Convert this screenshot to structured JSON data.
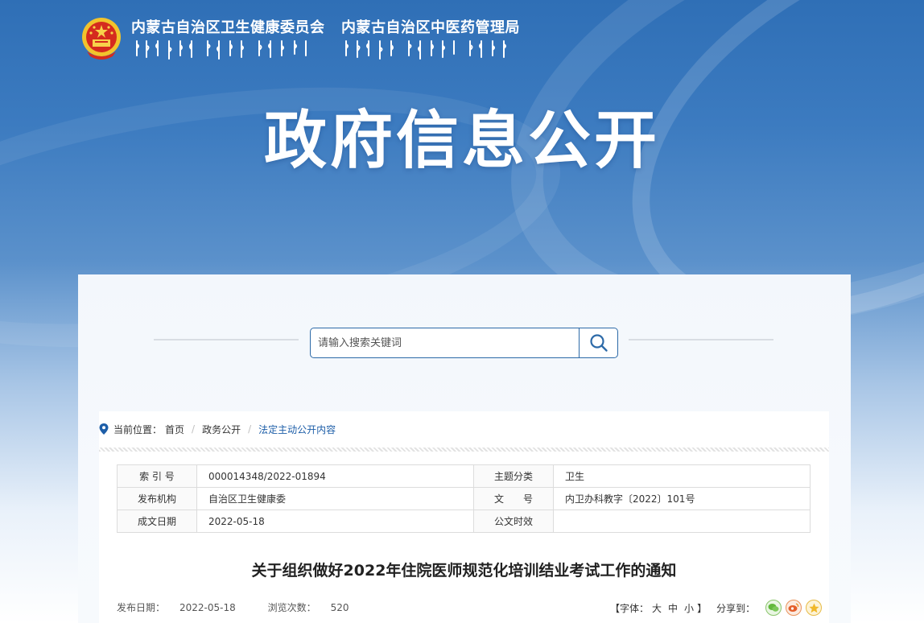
{
  "header": {
    "org_name_1": "内蒙古自治区卫生健康委员会",
    "org_name_2": "内蒙古自治区中医药管理局",
    "page_title": "政府信息公开",
    "colors": {
      "banner_blue": "#2f6fb6",
      "accent": "#1d5ea8"
    }
  },
  "search": {
    "placeholder": "请输入搜索关键词",
    "icon": "search-icon"
  },
  "breadcrumb": {
    "label": "当前位置：",
    "items": [
      "首页",
      "政务公开",
      "法定主动公开内容"
    ]
  },
  "meta": {
    "rows": [
      {
        "k1": "索 引 号",
        "v1": "000014348/2022-01894",
        "k2": "主题分类",
        "v2": "卫生"
      },
      {
        "k1": "发布机构",
        "v1": "自治区卫生健康委",
        "k2": "文　　号",
        "v2": "内卫办科教字〔2022〕101号"
      },
      {
        "k1": "成文日期",
        "v1": "2022-05-18",
        "k2": "公文时效",
        "v2": ""
      }
    ]
  },
  "article": {
    "title": "关于组织做好2022年住院医师规范化培训结业考试工作的通知",
    "publish_label": "发布日期：",
    "publish_date": "2022-05-18",
    "views_label": "浏览次数：",
    "views": "520"
  },
  "tools": {
    "font_open": "【字体：",
    "font_large": "大",
    "font_medium": "中",
    "font_small": "小",
    "font_close": "】",
    "share_label": "分享到：",
    "share_icons": [
      "wechat-icon",
      "weibo-icon",
      "favorite-icon"
    ]
  }
}
